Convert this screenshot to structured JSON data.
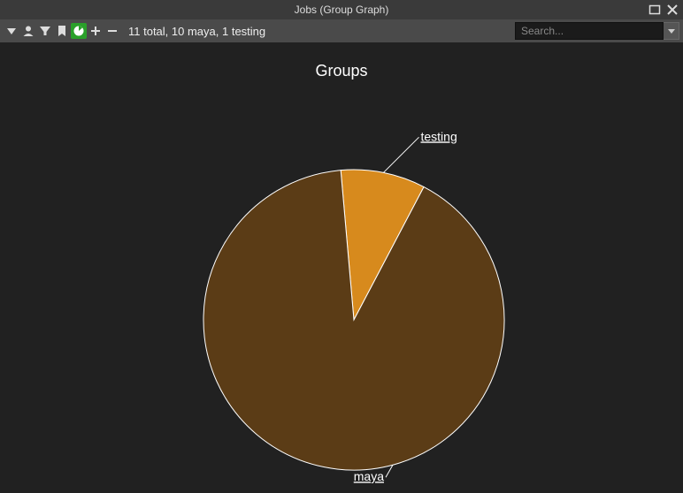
{
  "window": {
    "title": "Jobs (Group Graph)"
  },
  "toolbar": {
    "status_text": "11 total, 10 maya, 1 testing",
    "search_placeholder": "Search...",
    "icons": {
      "dropdown": "dropdown-icon",
      "user": "user-icon",
      "filter": "filter-icon",
      "bookmark": "bookmark-icon",
      "graph": "graph-icon",
      "plus": "plus-icon",
      "minus": "minus-icon"
    }
  },
  "chart_data": {
    "type": "pie",
    "title": "Groups",
    "series": [
      {
        "name": "maya",
        "value": 10,
        "color": "#5b3c16"
      },
      {
        "name": "testing",
        "value": 1,
        "color": "#d78a1d"
      }
    ],
    "total": 11,
    "labels": {
      "maya": "maya",
      "testing": "testing"
    }
  },
  "colors": {
    "background": "#212121",
    "toolbar": "#4a4a4a",
    "titlebar": "#3a3a3a",
    "accent_active": "#2aa02a"
  }
}
